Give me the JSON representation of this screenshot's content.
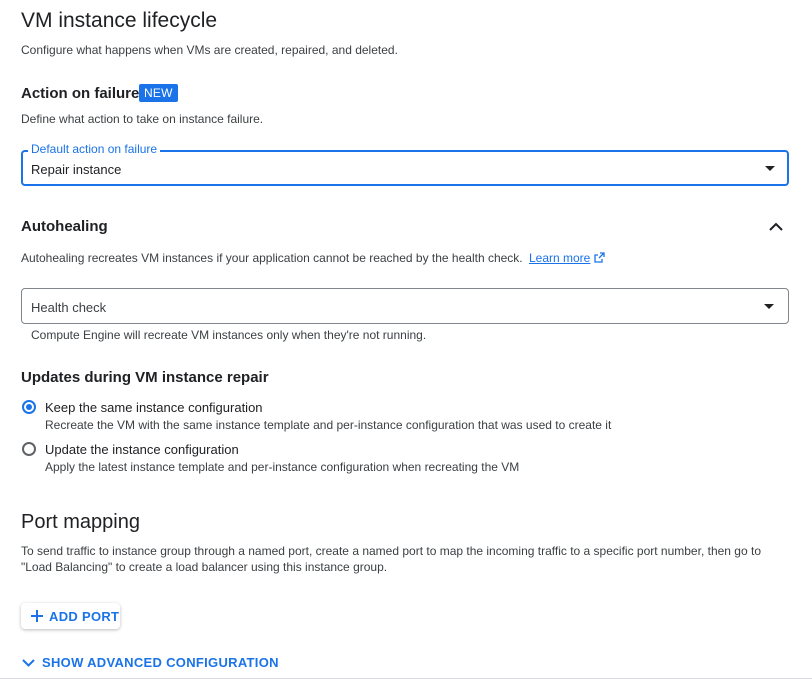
{
  "lifecycle": {
    "title": "VM instance lifecycle",
    "description": "Configure what happens when VMs are created, repaired, and deleted."
  },
  "action_on_failure": {
    "title": "Action on failure",
    "badge": "NEW",
    "description": "Define what action to take on instance failure.",
    "field_label": "Default action on failure",
    "selected_value": "Repair instance"
  },
  "autohealing": {
    "title": "Autohealing",
    "description": "Autohealing recreates VM instances if your application cannot be reached by the health check.",
    "learn_more": "Learn more",
    "health_check_placeholder": "Health check",
    "health_check_help": "Compute Engine will recreate VM instances only when they're not running."
  },
  "updates": {
    "title": "Updates during VM instance repair",
    "options": [
      {
        "label": "Keep the same instance configuration",
        "help": "Recreate the VM with the same instance template and per-instance configuration that was used to create it",
        "checked": true
      },
      {
        "label": "Update the instance configuration",
        "help": "Apply the latest instance template and per-instance configuration when recreating the VM",
        "checked": false
      }
    ]
  },
  "port_mapping": {
    "title": "Port mapping",
    "description_line1": "To send traffic to instance group through a named port, create a named port to map the incoming traffic to a specific port number, then go to",
    "description_line2": "\"Load Balancing\" to create a load balancer using this instance group.",
    "add_port_label": "ADD PORT"
  },
  "advanced": {
    "label": "SHOW ADVANCED CONFIGURATION"
  },
  "colors": {
    "accent": "#1a73e8",
    "text": "#202124",
    "secondary_text": "#3c4043"
  }
}
